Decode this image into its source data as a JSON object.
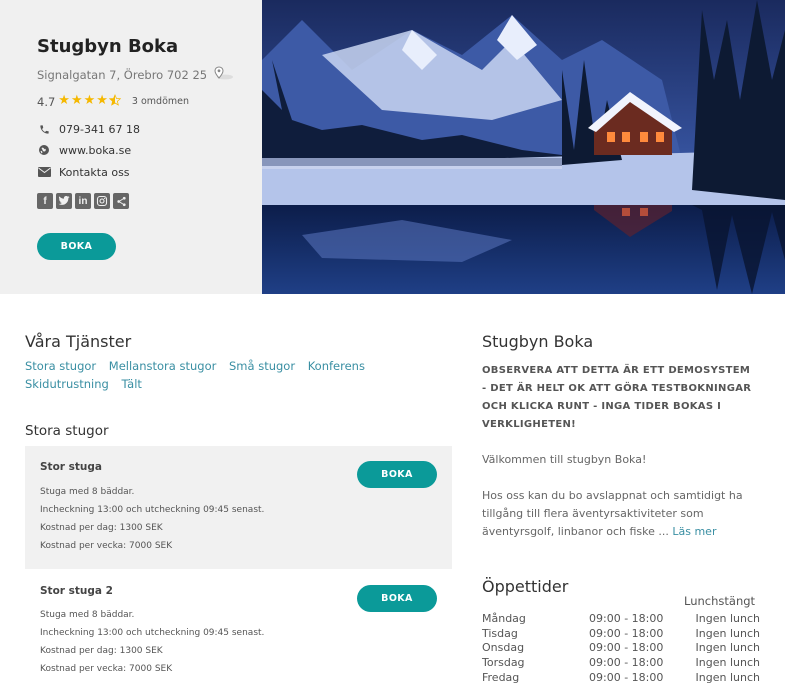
{
  "business": {
    "name": "Stugbyn Boka",
    "address": "Signalgatan 7, Örebro 702 25",
    "rating": "4.7",
    "star_count": 4.5,
    "reviews": "3 omdömen",
    "phone": "079-341 67 18",
    "website": "www.boka.se",
    "contact": "Kontakta oss",
    "book_label": "BOKA",
    "social_icons": [
      "facebook-icon",
      "twitter-icon",
      "linkedin-icon",
      "instagram-icon",
      "share-icon"
    ]
  },
  "services": {
    "title": "Våra Tjänster",
    "links": [
      "Stora stugor",
      "Mellanstora stugor",
      "Små stugor",
      "Konferens",
      "Skidutrustning",
      "Tält"
    ],
    "category_title": "Stora stugor",
    "listings": [
      {
        "name": "Stor stuga",
        "lines": [
          "Stuga med 8 bäddar.",
          "Incheckning 13:00 och utcheckning 09:45 senast.",
          "Kostnad per dag: 1300 SEK",
          "Kostnad per vecka: 7000 SEK"
        ],
        "button": "BOKA"
      },
      {
        "name": "Stor stuga 2",
        "lines": [
          "Stuga med 8 bäddar.",
          "Incheckning 13:00 och utcheckning 09:45 senast.",
          "Kostnad per dag: 1300 SEK",
          "Kostnad per vecka: 7000 SEK"
        ],
        "button": "BOKA"
      }
    ]
  },
  "about": {
    "title": "Stugbyn Boka",
    "notice": "OBSERVERA ATT DETTA ÄR ETT DEMOSYSTEM - DET ÄR HELT OK ATT GÖRA TESTBOKNINGAR OCH KLICKA RUNT - INGA TIDER BOKAS I VERKLIGHETEN!",
    "welcome": "Välkommen till stugbyn Boka!",
    "description": "Hos oss kan du bo avslappnat och samtidigt ha tillgång till flera äventyrsaktiviteter som äventyrsgolf, linbanor och fiske ...",
    "read_more": "Läs mer"
  },
  "hours": {
    "title": "Öppettider",
    "lunch_header": "Lunchstängt",
    "rows": [
      {
        "day": "Måndag",
        "time": "09:00 - 18:00",
        "lunch": "Ingen lunch"
      },
      {
        "day": "Tisdag",
        "time": "09:00 - 18:00",
        "lunch": "Ingen lunch"
      },
      {
        "day": "Onsdag",
        "time": "09:00 - 18:00",
        "lunch": "Ingen lunch"
      },
      {
        "day": "Torsdag",
        "time": "09:00 - 18:00",
        "lunch": "Ingen lunch"
      },
      {
        "day": "Fredag",
        "time": "09:00 - 18:00",
        "lunch": "Ingen lunch"
      }
    ]
  },
  "colors": {
    "accent": "#0b9a99",
    "link": "#3a8fa3",
    "star": "#f5b800"
  }
}
